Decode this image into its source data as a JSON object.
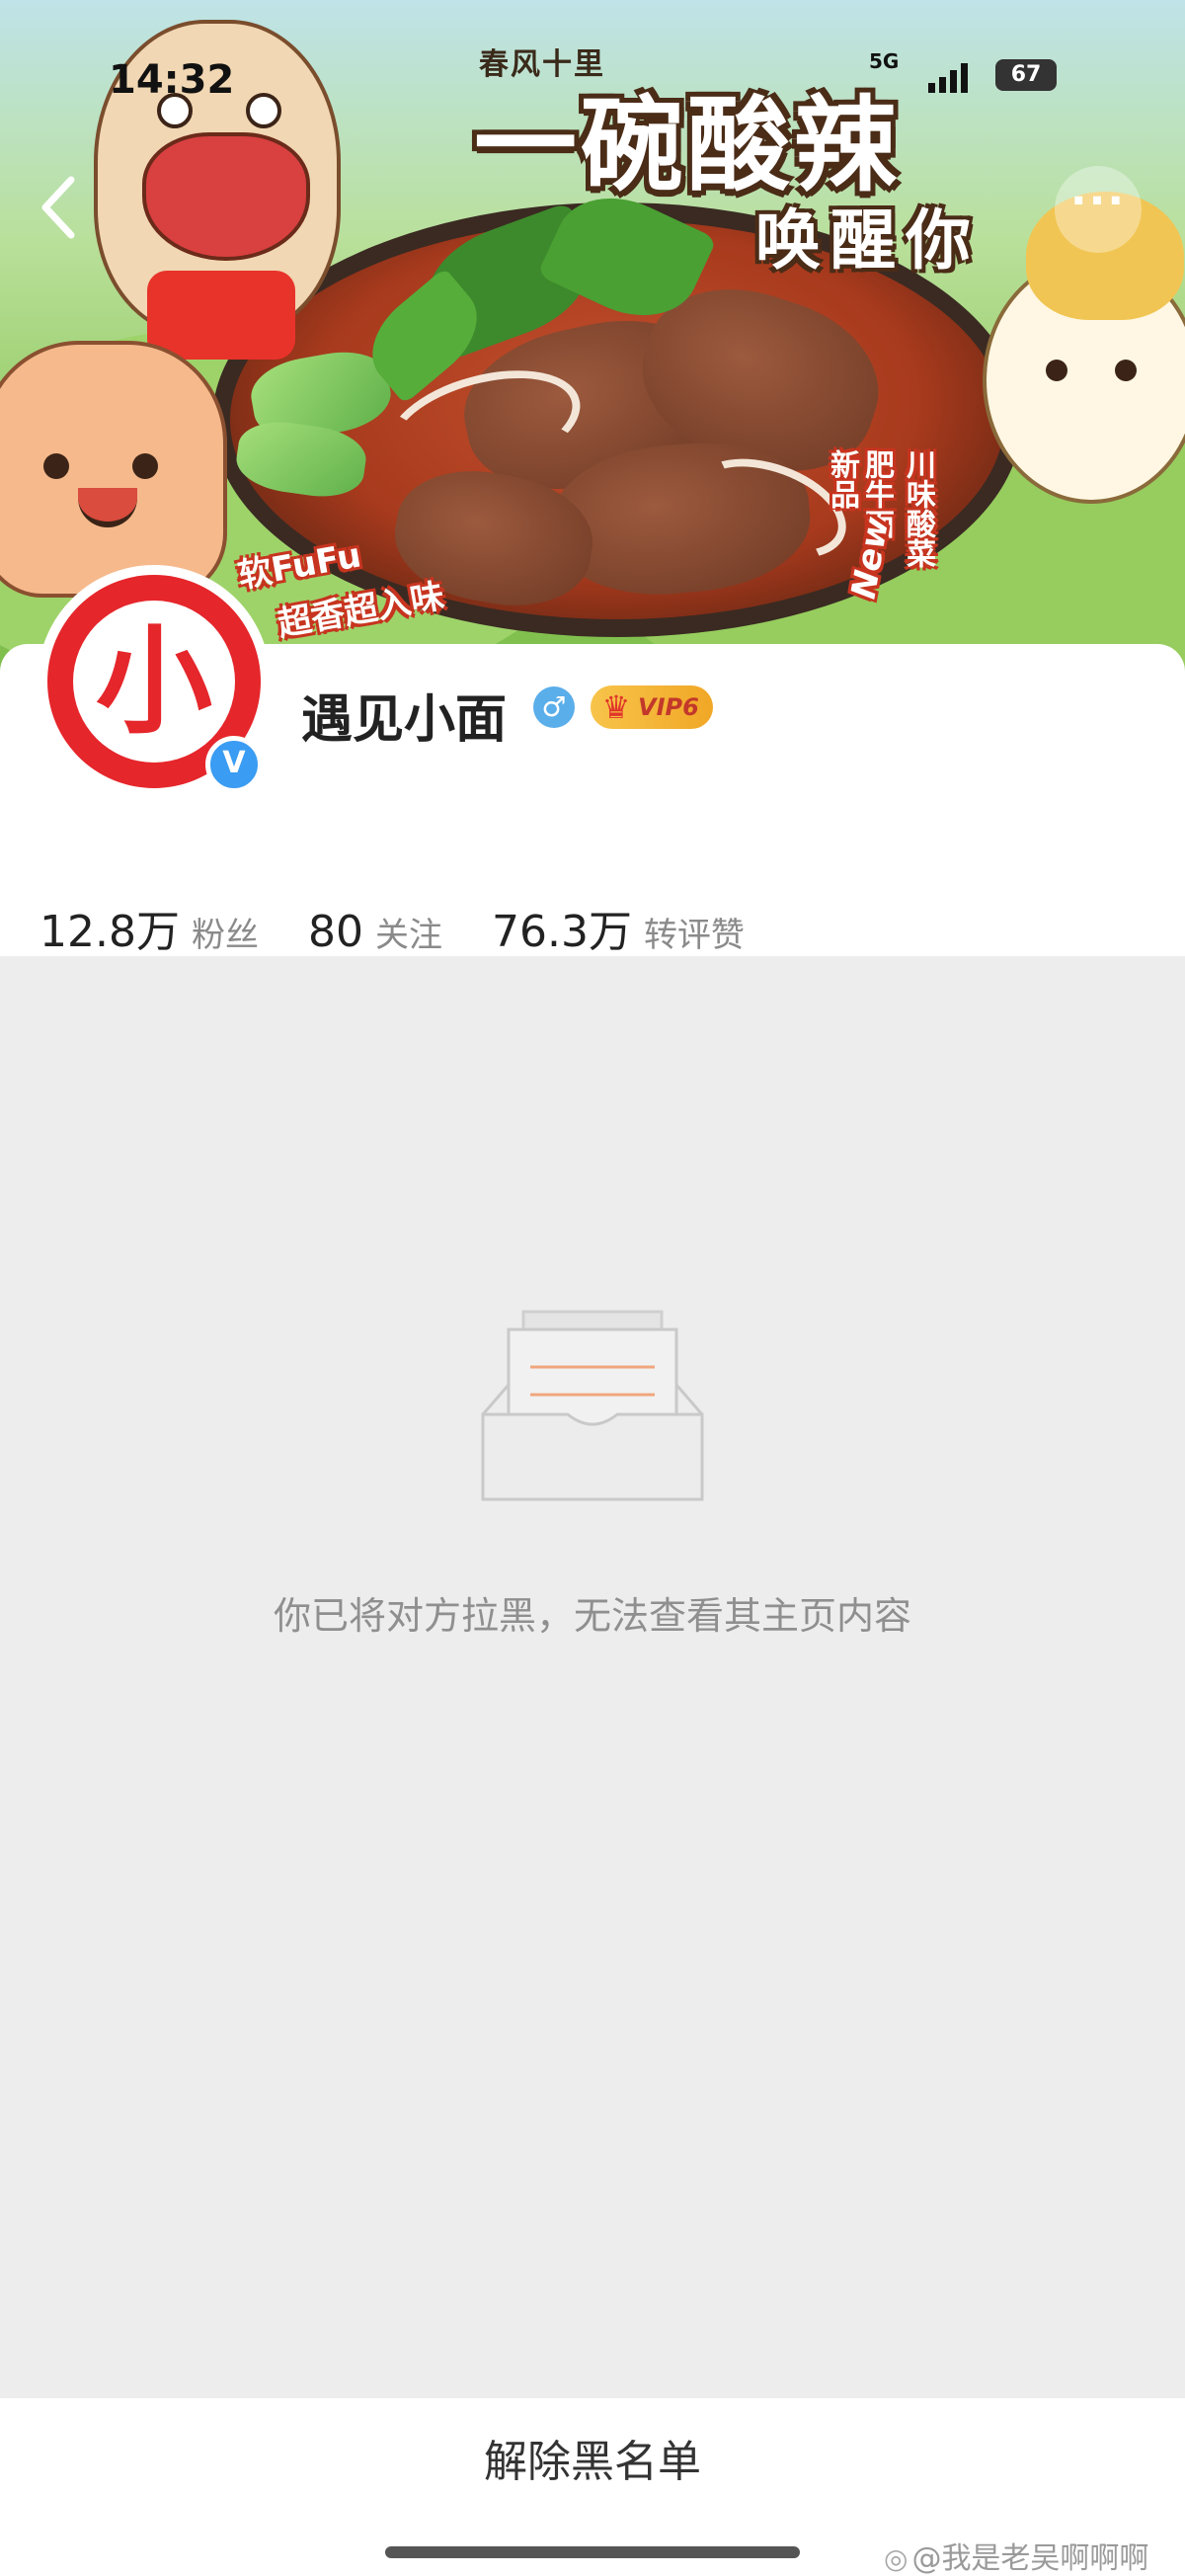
{
  "status_bar": {
    "time": "14:32",
    "network": "5G",
    "battery": "67"
  },
  "banner": {
    "brand_small": "春风十里",
    "headline": "一碗酸辣",
    "subline": "唤醒你",
    "soft": "软FuFu",
    "fragrant": "超香超入味",
    "vertical_1": "川味酸菜",
    "vertical_2": "肥牛面",
    "vertical_3": "新品",
    "new": "New"
  },
  "nav": {
    "more": "···"
  },
  "profile": {
    "avatar_char": "小",
    "name": "遇见小面",
    "gender_symbol": "♂",
    "vip_label": "VIP6",
    "verified_symbol": "V"
  },
  "stats": [
    {
      "value": "12.8万",
      "label": "粉丝"
    },
    {
      "value": "80",
      "label": "关注"
    },
    {
      "value": "76.3万",
      "label": "转评赞"
    }
  ],
  "empty_state": {
    "message": "你已将对方拉黑，无法查看其主页内容"
  },
  "actions": {
    "unblock": "解除黑名单"
  },
  "watermark": "@我是老吴啊啊啊",
  "colors": {
    "brand_red": "#e5262b",
    "verified_blue": "#3a9cf2",
    "vip_gold": "#f1a726"
  }
}
